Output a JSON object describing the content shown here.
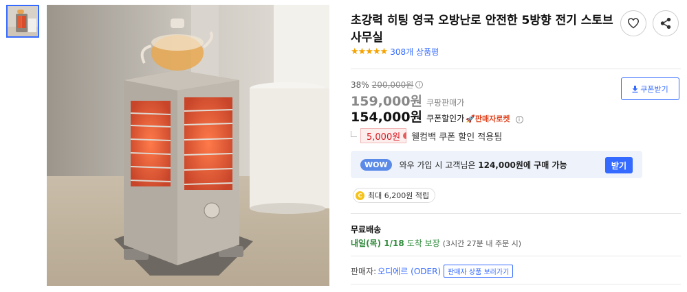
{
  "product": {
    "title": "초강력 히팅 영국 오방난로 안전한 5방향 전기 스토브 사무실",
    "rating_stars": "★★★★★",
    "review_count": "308개 상품평"
  },
  "actions": {
    "wishlist_icon": "heart-icon",
    "share_icon": "share-icon"
  },
  "pricing": {
    "discount_rate": "38%",
    "original_price": "200,000원",
    "info_glyph": "i",
    "sale_price": "159,000원",
    "sale_label": "쿠팡판매가",
    "coupon_price": "154,000원",
    "coupon_label": "쿠폰할인가",
    "rocket_label": "🚀판매자로켓",
    "coupon_button": "쿠폰받기"
  },
  "coupon": {
    "amount": "5,000원",
    "text": "웰컴백 쿠폰 할인 적용됨"
  },
  "wow": {
    "badge": "WOW",
    "text_prefix": "와우 가입 시 고객님은 ",
    "text_price": "124,000원",
    "text_suffix": "에 구매 가능",
    "button": "받기"
  },
  "points": {
    "coin": "C",
    "text": "최대 6,200원 적립"
  },
  "shipping": {
    "title": "무료배송",
    "date": "내일(목) 1/18",
    "arrive": "도착 보장",
    "note": "(3시간 27분 내 주문 시)"
  },
  "seller": {
    "label": "판매자:",
    "name": "오디에르 (ODER)",
    "button": "판매자 상품 보러가기"
  },
  "colors": {
    "accent": "#346aff",
    "coupon_red": "#d71920",
    "shipping_green": "#2e8b3a",
    "star": "#f4a300"
  }
}
